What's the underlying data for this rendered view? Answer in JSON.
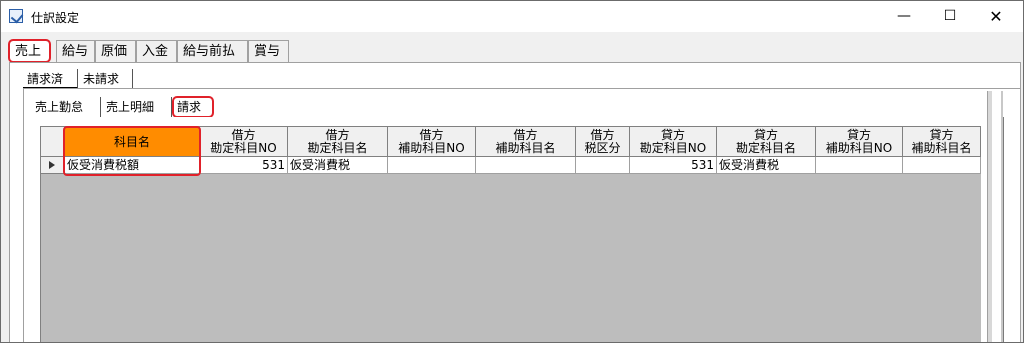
{
  "window": {
    "title": "仕訳設定",
    "minimize_label": "—",
    "maximize_label": "☐",
    "close_label": "✕"
  },
  "main_tabs": [
    {
      "label": "売上",
      "active": true,
      "highlighted": true
    },
    {
      "label": "給与",
      "active": false
    },
    {
      "label": "原価",
      "active": false
    },
    {
      "label": "入金",
      "active": false
    },
    {
      "label": "給与前払",
      "active": false
    },
    {
      "label": "賞与",
      "active": false
    }
  ],
  "sub_tabs": [
    {
      "label": "請求済",
      "active": true
    },
    {
      "label": "未請求",
      "active": false
    }
  ],
  "detail_tabs": [
    {
      "label": "売上勤怠",
      "active": false
    },
    {
      "label": "売上明細",
      "active": false
    },
    {
      "label": "請求",
      "active": true,
      "highlighted": true
    }
  ],
  "grid": {
    "columns": [
      {
        "line1": "科目名",
        "line2": "",
        "selected": true
      },
      {
        "line1": "借方",
        "line2": "勘定科目NO"
      },
      {
        "line1": "借方",
        "line2": "勘定科目名"
      },
      {
        "line1": "借方",
        "line2": "補助科目NO"
      },
      {
        "line1": "借方",
        "line2": "補助科目名"
      },
      {
        "line1": "借方",
        "line2": "税区分"
      },
      {
        "line1": "貸方",
        "line2": "勘定科目NO"
      },
      {
        "line1": "貸方",
        "line2": "勘定科目名"
      },
      {
        "line1": "貸方",
        "line2": "補助科目NO"
      },
      {
        "line1": "貸方",
        "line2": "補助科目名"
      }
    ],
    "rows": [
      {
        "cells": [
          "仮受消費税額",
          "531",
          "仮受消費税",
          "",
          "",
          "",
          "531",
          "仮受消費税",
          "",
          ""
        ]
      }
    ]
  },
  "colors": {
    "selected_header": "#ff8c00",
    "highlight": "#e0212a",
    "grid_background": "#bdbdbd"
  }
}
